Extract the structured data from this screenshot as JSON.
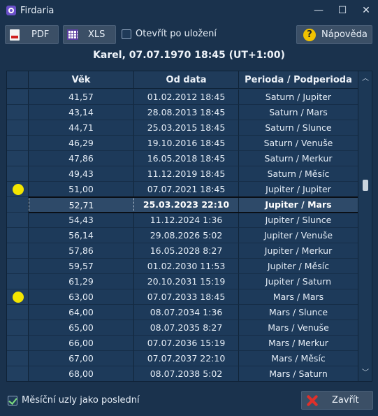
{
  "window": {
    "title": "Firdaria",
    "minimize_glyph": "—",
    "maximize_glyph": "☐",
    "close_glyph": "✕"
  },
  "toolbar": {
    "pdf_label": "PDF",
    "xls_label": "XLS",
    "open_after_save_label": "Otevřít po uložení",
    "open_after_save_checked": false,
    "help_label": "Nápověda",
    "help_glyph": "?"
  },
  "header": {
    "subject": "Karel, 07.07.1970 18:45 (UT+1:00)"
  },
  "table": {
    "columns": [
      "",
      "Věk",
      "Od data",
      "Perioda / Podperioda"
    ],
    "rows": [
      {
        "age": "41,57",
        "date": "01.02.2012 18:45",
        "period": "Saturn / Jupiter",
        "marker": false,
        "selected": false
      },
      {
        "age": "43,14",
        "date": "28.08.2013 18:45",
        "period": "Saturn / Mars",
        "marker": false,
        "selected": false
      },
      {
        "age": "44,71",
        "date": "25.03.2015 18:45",
        "period": "Saturn / Slunce",
        "marker": false,
        "selected": false
      },
      {
        "age": "46,29",
        "date": "19.10.2016 18:45",
        "period": "Saturn / Venuše",
        "marker": false,
        "selected": false
      },
      {
        "age": "47,86",
        "date": "16.05.2018 18:45",
        "period": "Saturn / Merkur",
        "marker": false,
        "selected": false
      },
      {
        "age": "49,43",
        "date": "11.12.2019 18:45",
        "period": "Saturn / Měsíc",
        "marker": false,
        "selected": false
      },
      {
        "age": "51,00",
        "date": "07.07.2021 18:45",
        "period": "Jupiter / Jupiter",
        "marker": true,
        "selected": false
      },
      {
        "age": "52,71",
        "date": "25.03.2023 22:10",
        "period": "Jupiter / Mars",
        "marker": false,
        "selected": true
      },
      {
        "age": "54,43",
        "date": "11.12.2024 1:36",
        "period": "Jupiter / Slunce",
        "marker": false,
        "selected": false
      },
      {
        "age": "56,14",
        "date": "29.08.2026 5:02",
        "period": "Jupiter / Venuše",
        "marker": false,
        "selected": false
      },
      {
        "age": "57,86",
        "date": "16.05.2028 8:27",
        "period": "Jupiter / Merkur",
        "marker": false,
        "selected": false
      },
      {
        "age": "59,57",
        "date": "01.02.2030 11:53",
        "period": "Jupiter / Měsíc",
        "marker": false,
        "selected": false
      },
      {
        "age": "61,29",
        "date": "20.10.2031 15:19",
        "period": "Jupiter / Saturn",
        "marker": false,
        "selected": false
      },
      {
        "age": "63,00",
        "date": "07.07.2033 18:45",
        "period": "Mars / Mars",
        "marker": true,
        "selected": false
      },
      {
        "age": "64,00",
        "date": "08.07.2034 1:36",
        "period": "Mars / Slunce",
        "marker": false,
        "selected": false
      },
      {
        "age": "65,00",
        "date": "08.07.2035 8:27",
        "period": "Mars / Venuše",
        "marker": false,
        "selected": false
      },
      {
        "age": "66,00",
        "date": "07.07.2036 15:19",
        "period": "Mars / Merkur",
        "marker": false,
        "selected": false
      },
      {
        "age": "67,00",
        "date": "07.07.2037 22:10",
        "period": "Mars / Měsíc",
        "marker": false,
        "selected": false
      },
      {
        "age": "68,00",
        "date": "08.07.2038 5:02",
        "period": "Mars / Saturn",
        "marker": false,
        "selected": false
      }
    ]
  },
  "scrollbar": {
    "up_glyph": "︿",
    "down_glyph": "﹀"
  },
  "footer": {
    "lunar_nodes_label": "Měsíční uzly jako poslední",
    "lunar_nodes_checked": true,
    "close_label": "Zavřít"
  },
  "colors": {
    "background": "#1a324d",
    "marker": "#f4e600",
    "close_icon": "#e0302a",
    "help_icon": "#f2c200"
  }
}
